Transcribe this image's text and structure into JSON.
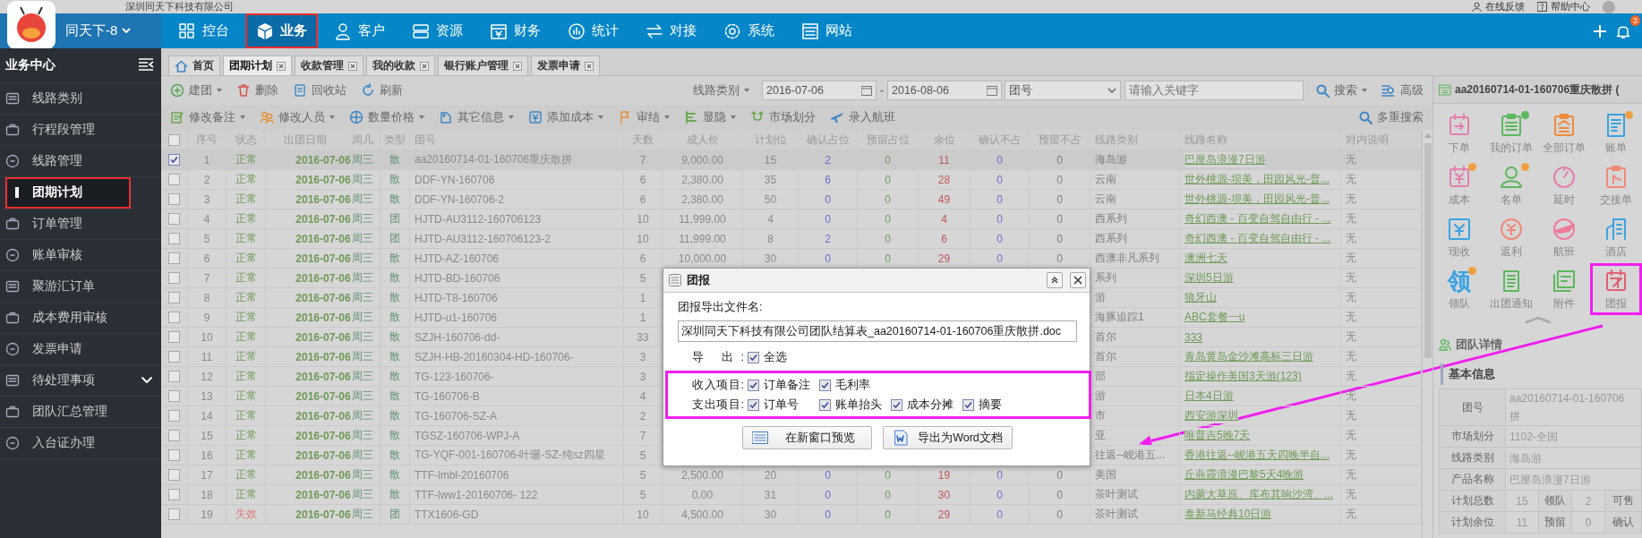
{
  "company": "深圳同天下科技有限公司",
  "top_links": [
    "在线反馈",
    "帮助中心"
  ],
  "account": "同天下-8",
  "nav": [
    {
      "label": "控台",
      "selected": false,
      "highlighted": false
    },
    {
      "label": "业务",
      "selected": true,
      "highlighted": true
    },
    {
      "label": "客户",
      "selected": false,
      "highlighted": false
    },
    {
      "label": "资源",
      "selected": false,
      "highlighted": false
    },
    {
      "label": "财务",
      "selected": false,
      "highlighted": false
    },
    {
      "label": "统计",
      "selected": false,
      "highlighted": false
    },
    {
      "label": "对接",
      "selected": false,
      "highlighted": false
    },
    {
      "label": "系统",
      "selected": false,
      "highlighted": false
    },
    {
      "label": "网站",
      "selected": false,
      "highlighted": false
    }
  ],
  "notification_count": "3",
  "sidebar": {
    "title": "业务中心",
    "items": [
      {
        "label": "线路类别",
        "kind": "link",
        "selected": false,
        "highlighted": false
      },
      {
        "label": "行程段管理",
        "kind": "link",
        "selected": false,
        "highlighted": false
      },
      {
        "label": "线路管理",
        "kind": "link",
        "selected": false,
        "highlighted": false
      },
      {
        "label": "团期计划",
        "kind": "link",
        "selected": true,
        "highlighted": true
      },
      {
        "label": "订单管理",
        "kind": "link",
        "selected": false,
        "highlighted": false
      },
      {
        "label": "账单审核",
        "kind": "link",
        "selected": false,
        "highlighted": false
      },
      {
        "label": "聚游汇订单",
        "kind": "link",
        "selected": false,
        "highlighted": false
      },
      {
        "label": "成本费用审核",
        "kind": "link",
        "selected": false,
        "highlighted": false
      },
      {
        "label": "发票申请",
        "kind": "link",
        "selected": false,
        "highlighted": false
      },
      {
        "label": "待处理事项",
        "kind": "group",
        "selected": false,
        "highlighted": false
      },
      {
        "label": "团队汇总管理",
        "kind": "link",
        "selected": false,
        "highlighted": false
      },
      {
        "label": "入台证办理",
        "kind": "link",
        "selected": false,
        "highlighted": false
      }
    ]
  },
  "tabs": [
    {
      "label": "首页",
      "kind": "home",
      "selected": false
    },
    {
      "label": "团期计划",
      "kind": "page",
      "selected": true
    },
    {
      "label": "收款管理",
      "kind": "page",
      "selected": false
    },
    {
      "label": "我的收款",
      "kind": "page",
      "selected": false
    },
    {
      "label": "银行账户管理",
      "kind": "page",
      "selected": false
    },
    {
      "label": "发票申请",
      "kind": "page",
      "selected": false
    }
  ],
  "toolbar": [
    {
      "label": "建团",
      "dropdown": true
    },
    {
      "label": "删除",
      "dropdown": false
    },
    {
      "label": "回收站",
      "dropdown": false
    },
    {
      "label": "刷新",
      "dropdown": false
    }
  ],
  "search": {
    "category": "线路类别",
    "date_from": "2016-07-06",
    "separator": "-",
    "date_to": "2016-08-06",
    "field": "团号",
    "placeholder": "请输入关键字",
    "search": "搜索",
    "advanced": "高级"
  },
  "actions": [
    {
      "label": "修改备注",
      "dropdown": true
    },
    {
      "label": "修改人员",
      "dropdown": true
    },
    {
      "label": "数量价格",
      "dropdown": true
    },
    {
      "label": "其它信息",
      "dropdown": true
    },
    {
      "label": "添加成本",
      "dropdown": true
    },
    {
      "label": "审结",
      "dropdown": true
    },
    {
      "label": "显隐",
      "dropdown": true
    },
    {
      "label": "市场划分",
      "dropdown": false
    },
    {
      "label": "录入航班",
      "dropdown": false
    }
  ],
  "multi_search": "多重搜索",
  "table": {
    "all_checked": false,
    "columns": [
      "序号",
      "状态",
      "出团日期",
      "周几",
      "类型",
      "团号",
      "天数",
      "成人价",
      "计划位",
      "确认占位",
      "预留占位",
      "余位",
      "确认不占",
      "预留不占",
      "线路类别",
      "线路名称",
      "对内说明"
    ],
    "rows": [
      {
        "checked": true,
        "invalid": false,
        "cells": [
          "1",
          "正常",
          "2016-07-06",
          "周三",
          "散",
          "aa20160714-01-160706重庆散拼",
          "7",
          "9,000.00",
          "15",
          "2",
          "0",
          "11",
          "0",
          "0",
          "海岛游",
          "巴厘岛浪漫7日游",
          "无"
        ]
      },
      {
        "checked": false,
        "invalid": false,
        "cells": [
          "2",
          "正常",
          "2016-07-06",
          "周三",
          "散",
          "DDF-YN-160706",
          "6",
          "2,380.00",
          "35",
          "6",
          "0",
          "28",
          "0",
          "0",
          "云南",
          "世外桃源-坝美，田园风光-普...",
          "无"
        ]
      },
      {
        "checked": false,
        "invalid": false,
        "cells": [
          "3",
          "正常",
          "2016-07-06",
          "周三",
          "散",
          "DDF-YN-160706-2",
          "6",
          "2,380.00",
          "50",
          "0",
          "0",
          "49",
          "0",
          "0",
          "云南",
          "世外桃源-坝美，田园风光-普...",
          "无"
        ]
      },
      {
        "checked": false,
        "invalid": false,
        "cells": [
          "4",
          "正常",
          "2016-07-06",
          "周三",
          "团",
          "HJTD-AU3112-160706123",
          "10",
          "11,999.00",
          "4",
          "0",
          "0",
          "4",
          "0",
          "0",
          "西系列",
          "奇幻西澳 - 百变自驾自由行 - ...",
          "无"
        ]
      },
      {
        "checked": false,
        "invalid": false,
        "cells": [
          "5",
          "正常",
          "2016-07-06",
          "周三",
          "团",
          "HJTD-AU3112-160706123-2",
          "10",
          "11,999.00",
          "8",
          "2",
          "0",
          "6",
          "0",
          "0",
          "西系列",
          "奇幻西澳 - 百变自驾自由行 - ...",
          "无"
        ]
      },
      {
        "checked": false,
        "invalid": false,
        "cells": [
          "6",
          "正常",
          "2016-07-06",
          "周三",
          "散",
          "HJTD-AZ-160706",
          "6",
          "10,000.00",
          "30",
          "0",
          "0",
          "29",
          "0",
          "0",
          "西澳非凡系列",
          "澳洲七天",
          "无"
        ]
      },
      {
        "checked": false,
        "invalid": false,
        "cells": [
          "7",
          "正常",
          "2016-07-06",
          "周三",
          "散",
          "HJTD-BD-160706",
          "5",
          null,
          null,
          null,
          null,
          null,
          null,
          null,
          "系列",
          "深圳5日游",
          "无"
        ]
      },
      {
        "checked": false,
        "invalid": false,
        "cells": [
          "8",
          "正常",
          "2016-07-06",
          "周三",
          "散",
          "HJTD-T8-160706",
          "1",
          null,
          null,
          null,
          null,
          null,
          null,
          null,
          "游",
          "狼牙山",
          "无"
        ]
      },
      {
        "checked": false,
        "invalid": false,
        "cells": [
          "9",
          "正常",
          "2016-07-06",
          "周三",
          "散",
          "HJTD-u1-160706",
          "1",
          null,
          null,
          null,
          null,
          null,
          null,
          null,
          "海豚追踪1",
          "ABC套餐一u",
          "无"
        ]
      },
      {
        "checked": false,
        "invalid": false,
        "cells": [
          "10",
          "正常",
          "2016-07-06",
          "周三",
          "散",
          "SZJH-160706-dd-",
          "33",
          null,
          null,
          null,
          null,
          null,
          null,
          null,
          "首尔",
          "333",
          "无"
        ]
      },
      {
        "checked": false,
        "invalid": false,
        "cells": [
          "11",
          "正常",
          "2016-07-06",
          "周三",
          "散",
          "SZJH-HB-20160304-HD-160706-",
          "3",
          null,
          null,
          null,
          null,
          null,
          null,
          null,
          "首尔",
          "青岛黄岛金沙滩高标三日游",
          "无"
        ]
      },
      {
        "checked": false,
        "invalid": false,
        "cells": [
          "12",
          "正常",
          "2016-07-06",
          "周三",
          "散",
          "TG-123-160706-",
          "3",
          null,
          null,
          null,
          null,
          null,
          null,
          null,
          "部",
          "指定操作美国3天游(123)",
          "无"
        ]
      },
      {
        "checked": false,
        "invalid": false,
        "cells": [
          "13",
          "正常",
          "2016-07-06",
          "周三",
          "散",
          "TG-160706-B",
          "4",
          null,
          null,
          null,
          null,
          null,
          null,
          null,
          "游",
          "日本4日游",
          "无"
        ]
      },
      {
        "checked": false,
        "invalid": false,
        "cells": [
          "14",
          "正常",
          "2016-07-06",
          "周三",
          "散",
          "TG-160706-SZ-A",
          "2",
          null,
          null,
          null,
          null,
          null,
          null,
          null,
          "市",
          "西安游深圳",
          "无"
        ]
      },
      {
        "checked": false,
        "invalid": false,
        "cells": [
          "15",
          "正常",
          "2016-07-06",
          "周三",
          "散",
          "TGSZ-160706-WPJ-A",
          "7",
          null,
          null,
          null,
          null,
          null,
          null,
          null,
          "亚",
          "唯普吉5晚7天",
          "无"
        ]
      },
      {
        "checked": false,
        "invalid": false,
        "cells": [
          "16",
          "正常",
          "2016-07-06",
          "周三",
          "散",
          "TG-YQF-001-160706-叶珊-SZ-纯sz四星",
          "5",
          null,
          null,
          null,
          null,
          null,
          null,
          null,
          "往返--岘港五...",
          "香港往返--岘港五天四晚半自...",
          "无"
        ]
      },
      {
        "checked": false,
        "invalid": false,
        "cells": [
          "17",
          "正常",
          "2016-07-06",
          "周三",
          "散",
          "TTF-lmbl-20160706",
          "5",
          "2,500.00",
          "20",
          "0",
          "0",
          "19",
          "0",
          "0",
          "美国",
          "丘燕霞浪漫巴黎5天4晚游",
          "无"
        ]
      },
      {
        "checked": false,
        "invalid": false,
        "cells": [
          "18",
          "正常",
          "2016-07-06",
          "周三",
          "散",
          "TTF-lww1-20160706- 122",
          "5",
          "0.00",
          "31",
          "0",
          "0",
          "30",
          "0",
          "0",
          "茶叶测试",
          "内蒙大草原、库布其响沙湾、...",
          "无"
        ]
      },
      {
        "checked": false,
        "invalid": true,
        "cells": [
          "19",
          "失效",
          "2016-07-06",
          "周三",
          "团",
          "TTX1606-GD",
          "10",
          "4,500.00",
          "30",
          "0",
          "0",
          "29",
          "0",
          "0",
          "茶叶测试",
          "泰新马经典10日游",
          "无"
        ]
      }
    ]
  },
  "dialog": {
    "title": "团报",
    "filename_label": "团报导出文件名:",
    "filename": "深圳同天下科技有限公司团队结算表_aa20160714-01-160706重庆散拼.doc",
    "export_row": {
      "label": "导 出:",
      "options": [
        {
          "label": "全选",
          "checked": true
        }
      ]
    },
    "item_rows_highlighted": true,
    "item_rows": [
      {
        "label": "收入项目:",
        "options": [
          {
            "label": "订单备注",
            "checked": true
          },
          {
            "label": "毛利率",
            "checked": true
          }
        ]
      },
      {
        "label": "支出项目:",
        "options": [
          {
            "label": "订单号",
            "checked": true
          },
          {
            "label": "账单抬头",
            "checked": true
          },
          {
            "label": "成本分摊",
            "checked": true
          },
          {
            "label": "摘要",
            "checked": true
          }
        ]
      }
    ],
    "buttons": [
      {
        "label": "在新窗口预览",
        "kind": "preview"
      },
      {
        "label": "导出为Word文档",
        "kind": "word"
      }
    ]
  },
  "panel": {
    "title": "aa20160714-01-160706重庆散拼 (",
    "actions": [
      {
        "label": "下单",
        "badge": false,
        "highlighted": false
      },
      {
        "label": "我的订单",
        "badge": true,
        "color": "#5cb85c",
        "highlighted": false
      },
      {
        "label": "全部订单",
        "badge": false,
        "highlighted": false
      },
      {
        "label": "账单",
        "badge": true,
        "color": "#f0a040",
        "highlighted": false
      },
      {
        "label": "成本",
        "badge": true,
        "color": "#f0a040",
        "highlighted": false
      },
      {
        "label": "名单",
        "badge": true,
        "color": "#f0a040",
        "highlighted": false
      },
      {
        "label": "延时",
        "badge": false,
        "highlighted": false
      },
      {
        "label": "交接单",
        "badge": false,
        "highlighted": false
      },
      {
        "label": "现收",
        "badge": false,
        "highlighted": false
      },
      {
        "label": "返利",
        "badge": false,
        "highlighted": false
      },
      {
        "label": "航班",
        "badge": false,
        "highlighted": false
      },
      {
        "label": "酒店",
        "badge": false,
        "highlighted": false
      },
      {
        "label": "领队",
        "glyph": "领",
        "badge": true,
        "color": "#f0a040",
        "highlighted": false
      },
      {
        "label": "出团通知",
        "badge": false,
        "highlighted": false
      },
      {
        "label": "附件",
        "badge": false,
        "highlighted": false
      },
      {
        "label": "团报",
        "badge": false,
        "highlighted": true
      }
    ],
    "details_title": "团队详情",
    "section": "基本信息",
    "info": [
      [
        {
          "kind": "label",
          "lines": [
            "团号"
          ]
        },
        {
          "kind": "value",
          "lines": [
            "aa20160714-01-160706",
            "拼"
          ]
        }
      ],
      [
        {
          "kind": "label",
          "lines": [
            "市场划分"
          ]
        },
        {
          "kind": "value",
          "lines": [
            "1102-全国"
          ]
        }
      ],
      [
        {
          "kind": "label",
          "lines": [
            "线路类别"
          ]
        },
        {
          "kind": "value",
          "lines": [
            "海岛游"
          ]
        }
      ],
      [
        {
          "kind": "label",
          "lines": [
            "产品名称"
          ]
        },
        {
          "kind": "value",
          "lines": [
            "巴厘岛浪漫7日游"
          ]
        }
      ],
      [
        {
          "kind": "label",
          "lines": [
            "计划总数"
          ]
        },
        {
          "kind": "value",
          "lines": [
            "15"
          ]
        },
        {
          "kind": "label",
          "lines": [
            "领队"
          ]
        },
        {
          "kind": "value",
          "lines": [
            "2"
          ]
        },
        {
          "kind": "label",
          "lines": [
            "可售"
          ]
        }
      ],
      [
        {
          "kind": "label",
          "lines": [
            "计划余位"
          ]
        },
        {
          "kind": "value",
          "lines": [
            "11"
          ]
        },
        {
          "kind": "label",
          "lines": [
            "预留"
          ]
        },
        {
          "kind": "value",
          "lines": [
            "0"
          ]
        },
        {
          "kind": "label",
          "lines": [
            "确认"
          ]
        }
      ]
    ]
  }
}
